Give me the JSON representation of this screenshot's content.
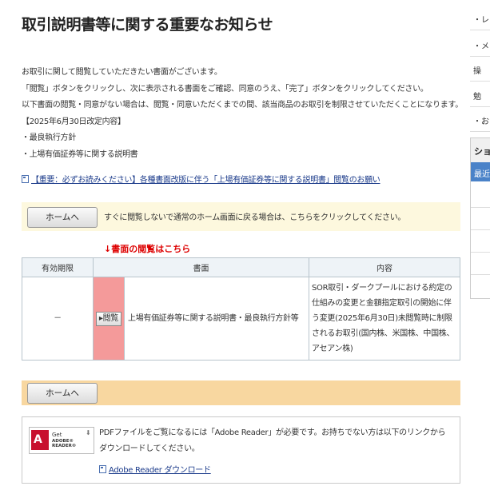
{
  "title": "取引説明書等に関する重要なお知らせ",
  "intro": [
    "お取引に関して閲覧していただきたい書面がございます。",
    "「閲覧」ボタンをクリックし、次に表示される書面をご確認、同意のうえ、「完了」ボタンをクリックしてください。",
    "以下書面の閲覧・同意がない場合は、閲覧・同意いただくまでの間、該当商品のお取引を制限させていただくことになります。",
    "【2025年6月30日改定内容】",
    "・最良執行方針",
    "・上場有価証券等に関する説明書"
  ],
  "notice_link": "【重要：必ずお読みください】各種書面改版に伴う「上場有価証券等に関する説明書」閲覧のお願い",
  "home_bar": {
    "button": "ホームへ",
    "text": "すぐに閲覧しないで通常のホーム画面に戻る場合は、こちらをクリックしてください。"
  },
  "table_caption": "↓書面の閲覧はこちら",
  "table": {
    "headers": [
      "有効期限",
      "書面",
      "内容"
    ],
    "rows": [
      {
        "period": "－",
        "action": "閲覧",
        "document": "上場有価証券等に関する説明書・最良執行方針等",
        "content": "SOR取引・ダークプールにおける約定の仕組みの変更と金額指定取引の開始に伴う変更(2025年6月30日)未閲覧時に制限されるお取引(国内株、米国株、中国株、アセアン株)"
      }
    ]
  },
  "home_bar2": {
    "button": "ホームへ"
  },
  "pdf": {
    "logo_get": "Get",
    "logo_reader": "ADOBE® READER®",
    "text": "PDFファイルをご覧になるには「Adobe Reader」が必要です。お持ちでない方は以下のリンクからダウンロードしてください。",
    "link": "Adobe Reader ダウンロード"
  },
  "sidebar": {
    "items": [
      "・レ",
      "・メ",
      "操",
      "勉",
      "・お"
    ],
    "panel_title": "ショ",
    "panel_tab": "最近"
  },
  "colors": {
    "home_bar_bg": "#fdf8de",
    "home_bar2_bg": "#f8d7a0",
    "caption_red": "#dd0000",
    "read_cell_bg": "#f49a9a",
    "link_blue": "#1a3a8a"
  }
}
